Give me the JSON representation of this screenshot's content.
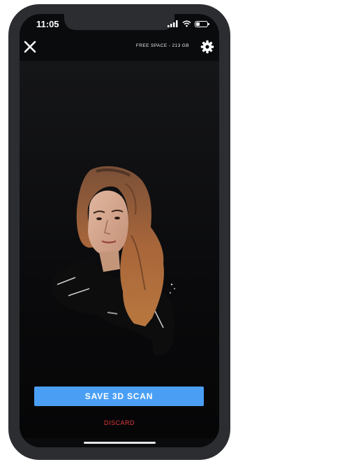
{
  "status_bar": {
    "time": "11:05",
    "icons": [
      "signal-icon",
      "wifi-icon",
      "battery-icon"
    ]
  },
  "top_bar": {
    "close_icon": "close-icon",
    "free_space_label": "FREE SPACE - 213 GB",
    "settings_icon": "gear-icon"
  },
  "actions": {
    "save_label": "SAVE 3D SCAN",
    "discard_label": "DISCARD"
  },
  "colors": {
    "save_button": "#4a9ff5",
    "discard_text": "#e0393a",
    "viewport_background": "#0a0b0d"
  }
}
